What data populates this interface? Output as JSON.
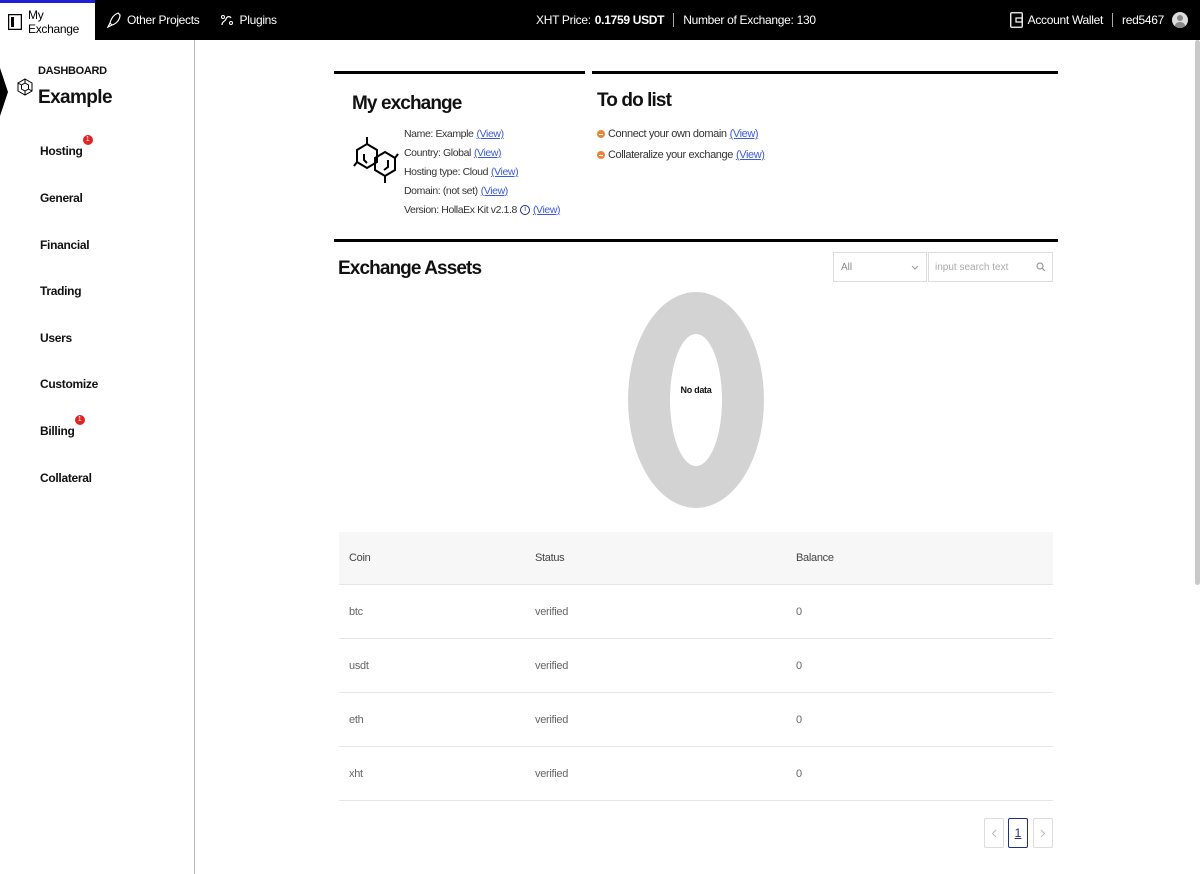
{
  "topbar": {
    "tabs": [
      {
        "label": "My Exchange",
        "icon": "exchange-logo-icon"
      },
      {
        "label": "Other Projects",
        "icon": "rocket-icon"
      },
      {
        "label": "Plugins",
        "icon": "plugin-icon"
      }
    ],
    "price_label": "XHT Price:",
    "price_value": "0.1759 USDT",
    "exchange_count_label": "Number of Exchange: 130",
    "account_wallet": "Account Wallet",
    "username": "red5467"
  },
  "sidebar": {
    "section_label": "DASHBOARD",
    "exchange_name": "Example",
    "items": [
      {
        "label": "Hosting",
        "badge": "1"
      },
      {
        "label": "General"
      },
      {
        "label": "Financial"
      },
      {
        "label": "Trading"
      },
      {
        "label": "Users"
      },
      {
        "label": "Customize"
      },
      {
        "label": "Billing",
        "badge": "1"
      },
      {
        "label": "Collateral"
      }
    ]
  },
  "my_exchange": {
    "title": "My exchange",
    "name": "Name: Example",
    "country": "Country: Global",
    "hosting": "Hosting type: Cloud",
    "domain": "Domain: (not set)",
    "version": "Version:  HollaEx Kit v2.1.8",
    "view": "(View)",
    "info_glyph": "i"
  },
  "todo": {
    "title": "To do list",
    "items": [
      "Connect your own domain",
      "Collateralize your exchange"
    ],
    "view": "(View)"
  },
  "assets": {
    "title": "Exchange Assets",
    "filter_value": "All",
    "search_placeholder": "input search text",
    "no_data": "No data",
    "columns": [
      "Coin",
      "Status",
      "Balance"
    ],
    "rows": [
      [
        "btc",
        "verified",
        "0"
      ],
      [
        "usdt",
        "verified",
        "0"
      ],
      [
        "eth",
        "verified",
        "0"
      ],
      [
        "xht",
        "verified",
        "0"
      ]
    ],
    "page": "1"
  }
}
